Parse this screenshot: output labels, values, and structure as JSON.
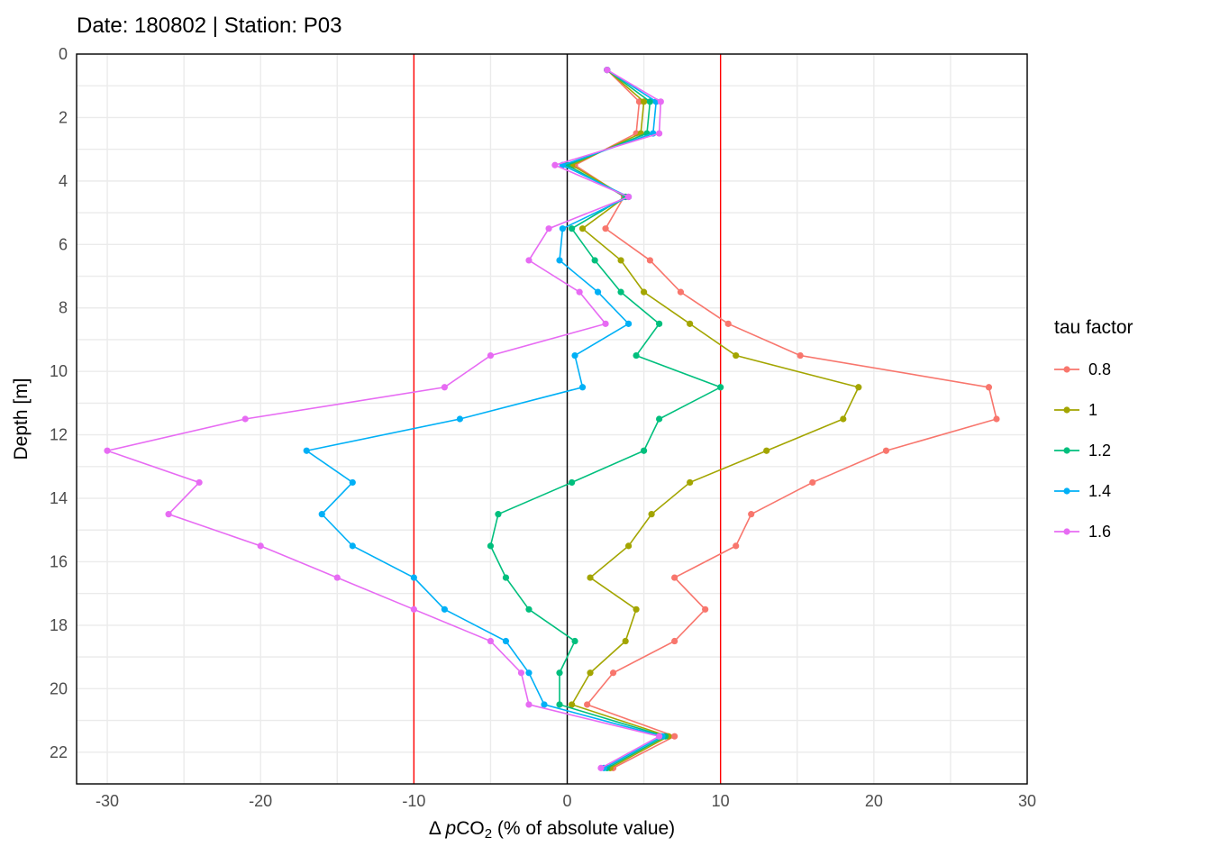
{
  "chart_data": {
    "type": "line",
    "title": "Date: 180802 | Station: P03",
    "xlabel": "Δ pCO₂ (% of absolute value)",
    "ylabel": "Depth [m]",
    "xlim": [
      -32,
      30
    ],
    "ylim": [
      23,
      0
    ],
    "x_ticks": [
      -30,
      -20,
      -10,
      0,
      10,
      20,
      30
    ],
    "y_ticks": [
      0,
      2,
      4,
      6,
      8,
      10,
      12,
      14,
      16,
      18,
      20,
      22
    ],
    "vlines": [
      {
        "x": 0,
        "color": "#000000"
      },
      {
        "x": -10,
        "color": "#ff0000"
      },
      {
        "x": 10,
        "color": "#ff0000"
      }
    ],
    "legend_title": "tau factor",
    "depths": [
      0.5,
      1.5,
      2.5,
      3.5,
      4.5,
      5.5,
      6.5,
      7.5,
      8.5,
      9.5,
      10.5,
      11.5,
      12.5,
      13.5,
      14.5,
      15.5,
      16.5,
      17.5,
      18.5,
      19.5,
      20.5,
      21.5,
      22.5
    ],
    "series": [
      {
        "name": "0.8",
        "color": "#F8766D",
        "values": [
          2.6,
          4.7,
          4.5,
          0.5,
          3.7,
          2.5,
          5.4,
          7.4,
          10.5,
          15.2,
          27.5,
          28.0,
          20.8,
          16.0,
          12.0,
          11.0,
          7.0,
          9.0,
          7.0,
          3.0,
          1.3,
          7.0,
          3.0
        ]
      },
      {
        "name": "1",
        "color": "#A3A500",
        "values": [
          2.6,
          5.0,
          4.8,
          0.3,
          3.8,
          1.0,
          3.5,
          5.0,
          8.0,
          11.0,
          19.0,
          18.0,
          13.0,
          8.0,
          5.5,
          4.0,
          1.5,
          4.5,
          3.8,
          1.5,
          0.3,
          6.6,
          2.8
        ]
      },
      {
        "name": "1.2",
        "color": "#00BF7D",
        "values": [
          2.6,
          5.4,
          5.2,
          0.0,
          3.8,
          0.3,
          1.8,
          3.5,
          6.0,
          4.5,
          10.0,
          6.0,
          5.0,
          0.3,
          -4.5,
          -5.0,
          -4.0,
          -2.5,
          0.5,
          -0.5,
          -0.5,
          6.4,
          2.6
        ]
      },
      {
        "name": "1.4",
        "color": "#00B0F6",
        "values": [
          2.6,
          5.8,
          5.6,
          -0.3,
          4.0,
          -0.3,
          -0.5,
          2.0,
          4.0,
          0.5,
          1.0,
          -7.0,
          -17.0,
          -14.0,
          -16.0,
          -14.0,
          -10.0,
          -8.0,
          -4.0,
          -2.5,
          -1.5,
          6.2,
          2.4
        ]
      },
      {
        "name": "1.6",
        "color": "#E76BF3",
        "values": [
          2.6,
          6.1,
          6.0,
          -0.8,
          4.0,
          -1.2,
          -2.5,
          0.8,
          2.5,
          -5.0,
          -8.0,
          -21.0,
          -30.0,
          -24.0,
          -26.0,
          -20.0,
          -15.0,
          -10.0,
          -5.0,
          -3.0,
          -2.5,
          6.0,
          2.2
        ]
      }
    ]
  }
}
